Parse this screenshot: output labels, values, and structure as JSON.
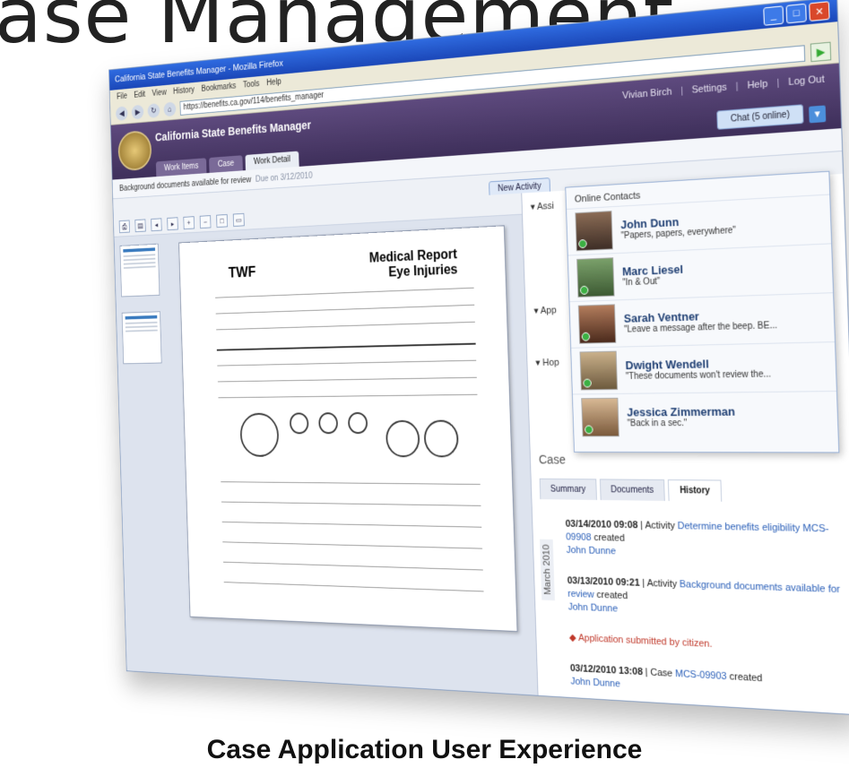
{
  "slide": {
    "title": "ase Management",
    "caption": "Case Application User Experience"
  },
  "browser": {
    "title": "California State Benefits Manager - Mozilla Firefox",
    "menu": [
      "File",
      "Edit",
      "View",
      "History",
      "Bookmarks",
      "Tools",
      "Help"
    ],
    "url": "https://benefits.ca.gov/114/benefits_manager"
  },
  "app": {
    "title": "California State Benefits Manager",
    "user_name": "Vivian Birch",
    "links": [
      "Settings",
      "Help",
      "Log Out"
    ],
    "chat_button": "Chat (5 online)",
    "tabs": [
      "Work Items",
      "Case",
      "Work Detail"
    ],
    "new_activity": "New Activity"
  },
  "infobar": {
    "text": "Background documents available for review",
    "date": "Due on 3/12/2010"
  },
  "document": {
    "form_title_line1": "Medical Report",
    "form_title_line2": "Eye Injuries",
    "logo": "TWF"
  },
  "side": {
    "accordions": [
      "Assi",
      "App",
      "Hop"
    ],
    "case_label": "Case",
    "tabs": [
      "Summary",
      "Documents",
      "History"
    ],
    "month": "March 2010",
    "history": [
      {
        "ts": "03/14/2010 09:08",
        "kind": "Activity",
        "link": "Determine benefits eligibility MCS-09908",
        "verb": "created",
        "user": "John Dunne"
      },
      {
        "ts": "03/13/2010 09:21",
        "kind": "Activity",
        "link": "Background documents available for review",
        "verb": "created",
        "user": "John Dunne"
      },
      {
        "ts": "",
        "kind": "",
        "link": "Application submitted by citizen.",
        "verb": "",
        "user": ""
      },
      {
        "ts": "03/12/2010 13:08",
        "kind": "Case",
        "link": "MCS-09903",
        "verb": "created",
        "user": "John Dunne"
      }
    ]
  },
  "chat": {
    "title": "Online Contacts",
    "contacts": [
      {
        "name": "John Dunn",
        "status": "\"Papers, papers, everywhere\""
      },
      {
        "name": "Marc Liesel",
        "status": "\"In & Out\""
      },
      {
        "name": "Sarah Ventner",
        "status": "\"Leave a message after the beep. BE..."
      },
      {
        "name": "Dwight Wendell",
        "status": "\"These documents won't review the..."
      },
      {
        "name": "Jessica Zimmerman",
        "status": "\"Back in a sec.\""
      }
    ]
  }
}
